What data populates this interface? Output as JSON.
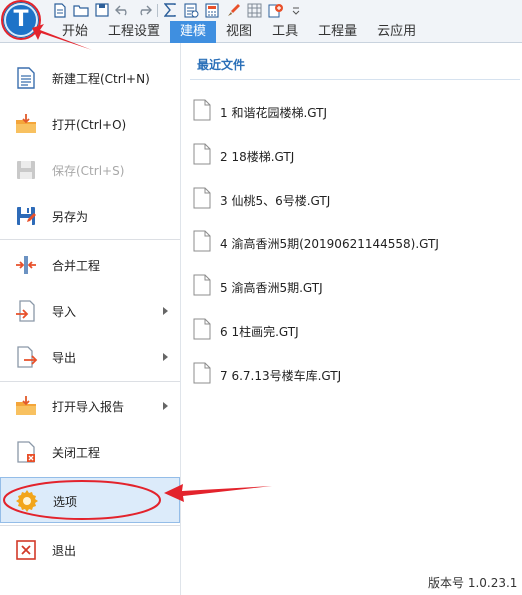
{
  "app": {
    "logo_letter": "T",
    "accent": "#3f8fe0"
  },
  "quick_access_icons": [
    "new-file-icon",
    "open-folder-icon",
    "save-icon",
    "undo-icon",
    "redo-icon",
    "sum-icon",
    "report-icon",
    "calculator-icon",
    "brush-icon",
    "grid-icon",
    "add-icon"
  ],
  "tabs": [
    {
      "label": "开始",
      "active": false
    },
    {
      "label": "工程设置",
      "active": false
    },
    {
      "label": "建模",
      "active": true
    },
    {
      "label": "视图",
      "active": false
    },
    {
      "label": "工具",
      "active": false
    },
    {
      "label": "工程量",
      "active": false
    },
    {
      "label": "云应用",
      "active": false
    }
  ],
  "menu": {
    "new_project": "新建工程(Ctrl+N)",
    "open": "打开(Ctrl+O)",
    "save": "保存(Ctrl+S)",
    "save_as": "另存为",
    "merge": "合并工程",
    "import": "导入",
    "export": "导出",
    "open_import_report": "打开导入报告",
    "close_project": "关闭工程",
    "options": "选项",
    "exit": "退出"
  },
  "recent": {
    "title": "最近文件",
    "files": [
      "1 和谐花园楼梯.GTJ",
      "2 18楼梯.GTJ",
      "3 仙桃5、6号楼.GTJ",
      "4 渝高香洲5期(20190621144558).GTJ",
      "5 渝高香洲5期.GTJ",
      "6 1柱画完.GTJ",
      "7 6.7.13号楼车库.GTJ"
    ]
  },
  "version": "版本号 1.0.23.1",
  "annotation_color": "#e3232c"
}
